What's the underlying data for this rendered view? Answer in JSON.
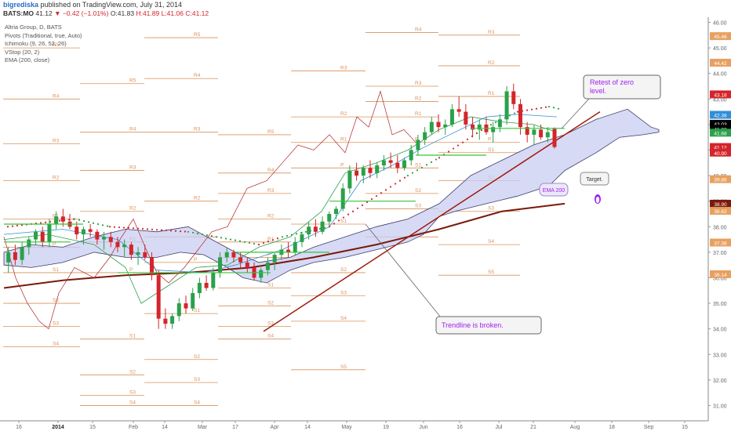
{
  "header": {
    "author": "bigrediska",
    "published": "published on TradingView.com, July 31, 2014"
  },
  "ticker": {
    "symbol": "BATS:MO",
    "last": "41.12",
    "change": "▼ −0.42 (−1.01%)",
    "open": "O:41.83",
    "high": "H:41.89",
    "low": "L:41.06",
    "close": "C:41.12"
  },
  "legend": [
    "Altria Group, D, BATS",
    "Pivots (Traditional, true, Auto)",
    "Ichimoku (9, 26, 52, 26)",
    "VStop (20, 2)",
    "EMA (200, close)"
  ],
  "colors": {
    "up": "#2aa14a",
    "down": "#d3252b",
    "pivot": "#d9905a",
    "trend": "#a01a0a",
    "ema": "#7a1a0a",
    "cloud_fill": "#c9cdf2",
    "cloud_line": "#3d3d6b",
    "annot": "#a020f0"
  },
  "chart_data": {
    "type": "candlestick",
    "symbol": "Altria Group, D, BATS",
    "ylim": [
      30.4,
      46.2
    ],
    "y_ticks": [
      31.0,
      32.0,
      33.0,
      34.0,
      35.0,
      36.0,
      37.0,
      38.0,
      39.0,
      40.0,
      41.0,
      42.0,
      43.0,
      44.0,
      45.0,
      46.0
    ],
    "x_ticks": [
      "16",
      "2014",
      "15",
      "Feb",
      "14",
      "Mar",
      "17",
      "Apr",
      "14",
      "May",
      "19",
      "Jun",
      "16",
      "Jul",
      "21",
      "Aug",
      "18",
      "Sep",
      "15"
    ],
    "price_tags": [
      {
        "label": "45.46",
        "value": 45.46,
        "color": "#e8a060"
      },
      {
        "label": "44.42",
        "value": 44.42,
        "color": "#e8a060"
      },
      {
        "label": "43.18",
        "value": 43.18,
        "color": "#d3252b"
      },
      {
        "label": "42.38",
        "value": 42.38,
        "color": "#2f8fd8"
      },
      {
        "label": "42.03",
        "value": 42.03,
        "color": "#000000"
      },
      {
        "label": "41.83",
        "value": 41.83,
        "color": "#000000"
      },
      {
        "label": "41.68",
        "value": 41.68,
        "color": "#2aa14a"
      },
      {
        "label": "41.12",
        "value": 41.12,
        "color": "#d3252b"
      },
      {
        "label": "40.90",
        "value": 40.9,
        "color": "#d3252b"
      },
      {
        "label": "39.86",
        "value": 39.86,
        "color": "#e8a060"
      },
      {
        "label": "38.90",
        "value": 38.9,
        "color": "#7a1a0a"
      },
      {
        "label": "38.62",
        "value": 38.62,
        "color": "#e8a060"
      },
      {
        "label": "37.38",
        "value": 37.38,
        "color": "#e8a060"
      },
      {
        "label": "36.14",
        "value": 36.14,
        "color": "#e8a060"
      }
    ],
    "pivot_levels": [
      {
        "label": "R5",
        "value": 45.0,
        "start": 75
      },
      {
        "label": "R4",
        "value": 43.0,
        "start": 75
      },
      {
        "label": "R3",
        "value": 41.25,
        "start": 75
      },
      {
        "label": "R2",
        "value": 39.8,
        "start": 75
      },
      {
        "label": "R1",
        "value": 38.3,
        "start": 75
      },
      {
        "label": "P",
        "value": 37.2,
        "start": 75
      },
      {
        "label": "S1",
        "value": 36.2,
        "start": 75
      },
      {
        "label": "S2",
        "value": 35.0,
        "start": 75
      },
      {
        "label": "S3",
        "value": 34.1,
        "start": 75
      },
      {
        "label": "S4",
        "value": 33.3,
        "start": 75
      },
      {
        "label": "R5",
        "value": 43.6,
        "start": 173
      },
      {
        "label": "R4",
        "value": 41.7,
        "start": 173
      },
      {
        "label": "R3",
        "value": 40.2,
        "start": 173
      },
      {
        "label": "R2",
        "value": 38.6,
        "start": 173
      },
      {
        "label": "R1",
        "value": 37.4,
        "start": 173
      },
      {
        "label": "P",
        "value": 36.2,
        "start": 173
      },
      {
        "label": "S1",
        "value": 33.6,
        "start": 173
      },
      {
        "label": "S2",
        "value": 32.2,
        "start": 173
      },
      {
        "label": "S3",
        "value": 31.4,
        "start": 173
      },
      {
        "label": "S4",
        "value": 31.0,
        "start": 173
      },
      {
        "label": "R5",
        "value": 45.4,
        "start": 255
      },
      {
        "label": "R4",
        "value": 43.8,
        "start": 255
      },
      {
        "label": "R3",
        "value": 41.7,
        "start": 255
      },
      {
        "label": "R2",
        "value": 39.0,
        "start": 255
      },
      {
        "label": "R1",
        "value": 37.6,
        "start": 255
      },
      {
        "label": "P",
        "value": 36.6,
        "start": 255
      },
      {
        "label": "S1",
        "value": 34.6,
        "start": 255
      },
      {
        "label": "S2",
        "value": 32.8,
        "start": 255
      },
      {
        "label": "S3",
        "value": 31.9,
        "start": 255
      },
      {
        "label": "S4",
        "value": 31.0,
        "start": 255
      },
      {
        "label": "R5",
        "value": 41.6,
        "start": 349
      },
      {
        "label": "R4",
        "value": 40.1,
        "start": 349
      },
      {
        "label": "R3",
        "value": 39.3,
        "start": 349
      },
      {
        "label": "R2",
        "value": 38.3,
        "start": 349
      },
      {
        "label": "R1",
        "value": 37.4,
        "start": 349
      },
      {
        "label": "P",
        "value": 36.8,
        "start": 349
      },
      {
        "label": "S1",
        "value": 35.6,
        "start": 349
      },
      {
        "label": "S2",
        "value": 34.9,
        "start": 349
      },
      {
        "label": "S3",
        "value": 34.1,
        "start": 349
      },
      {
        "label": "S4",
        "value": 33.6,
        "start": 349
      },
      {
        "label": "R4",
        "value": 46.5,
        "start": 442
      },
      {
        "label": "R3",
        "value": 44.1,
        "start": 442
      },
      {
        "label": "R2",
        "value": 42.3,
        "start": 442
      },
      {
        "label": "R1",
        "value": 41.3,
        "start": 442
      },
      {
        "label": "P",
        "value": 40.3,
        "start": 442
      },
      {
        "label": "S1",
        "value": 38.1,
        "start": 442
      },
      {
        "label": "S2",
        "value": 36.2,
        "start": 442
      },
      {
        "label": "S3",
        "value": 35.3,
        "start": 442
      },
      {
        "label": "S4",
        "value": 34.3,
        "start": 442
      },
      {
        "label": "S5",
        "value": 32.4,
        "start": 442
      },
      {
        "label": "R4",
        "value": 45.6,
        "start": 537
      },
      {
        "label": "R3",
        "value": 43.5,
        "start": 537
      },
      {
        "label": "R2",
        "value": 42.9,
        "start": 537
      },
      {
        "label": "R1",
        "value": 42.3,
        "start": 537
      },
      {
        "label": "P",
        "value": 41.3,
        "start": 537
      },
      {
        "label": "S1",
        "value": 40.3,
        "start": 537
      },
      {
        "label": "S2",
        "value": 39.3,
        "start": 537
      },
      {
        "label": "S3",
        "value": 38.7,
        "start": 537
      },
      {
        "label": "S4",
        "value": 37.6,
        "start": 537
      },
      {
        "label": "R3",
        "value": 45.5,
        "start": 630
      },
      {
        "label": "R2",
        "value": 44.3,
        "start": 630
      },
      {
        "label": "R1",
        "value": 43.1,
        "start": 630
      },
      {
        "label": "P",
        "value": 41.3,
        "start": 630
      },
      {
        "label": "S1",
        "value": 40.9,
        "start": 630
      },
      {
        "label": "S2",
        "value": 39.8,
        "start": 630
      },
      {
        "label": "S3",
        "value": 38.6,
        "start": 630
      },
      {
        "label": "S4",
        "value": 37.3,
        "start": 630
      },
      {
        "label": "S5",
        "value": 36.1,
        "start": 630
      }
    ],
    "candles": [
      [
        36.6,
        37.2,
        36.2,
        37.0
      ],
      [
        37.0,
        37.3,
        36.5,
        36.7
      ],
      [
        36.7,
        37.4,
        36.5,
        37.2
      ],
      [
        37.2,
        37.6,
        36.9,
        37.5
      ],
      [
        37.5,
        37.9,
        37.3,
        37.8
      ],
      [
        37.8,
        38.0,
        37.2,
        37.4
      ],
      [
        37.4,
        38.3,
        37.2,
        38.1
      ],
      [
        38.1,
        38.6,
        37.9,
        38.4
      ],
      [
        38.4,
        38.7,
        38.0,
        38.2
      ],
      [
        38.2,
        38.5,
        37.9,
        38.0
      ],
      [
        38.0,
        38.2,
        37.5,
        37.7
      ],
      [
        37.7,
        38.0,
        37.3,
        37.9
      ],
      [
        37.9,
        38.1,
        37.6,
        37.8
      ],
      [
        37.8,
        37.9,
        37.3,
        37.5
      ],
      [
        37.5,
        37.8,
        37.1,
        37.6
      ],
      [
        37.6,
        37.8,
        37.2,
        37.4
      ],
      [
        37.4,
        37.6,
        37.0,
        37.2
      ],
      [
        37.2,
        37.5,
        36.8,
        37.3
      ],
      [
        37.3,
        37.4,
        36.7,
        36.9
      ],
      [
        36.9,
        37.2,
        36.5,
        37.0
      ],
      [
        37.0,
        37.3,
        36.7,
        36.8
      ],
      [
        36.8,
        37.0,
        35.9,
        36.1
      ],
      [
        36.1,
        36.3,
        34.0,
        34.4
      ],
      [
        34.4,
        34.8,
        34.0,
        34.2
      ],
      [
        34.2,
        34.6,
        34.0,
        34.5
      ],
      [
        34.5,
        35.2,
        34.3,
        35.0
      ],
      [
        35.0,
        35.3,
        34.6,
        34.8
      ],
      [
        34.8,
        35.6,
        34.7,
        35.4
      ],
      [
        35.4,
        36.0,
        35.2,
        35.8
      ],
      [
        35.8,
        36.1,
        35.5,
        35.6
      ],
      [
        35.6,
        36.4,
        35.5,
        36.2
      ],
      [
        36.2,
        37.0,
        36.0,
        36.8
      ],
      [
        36.8,
        37.2,
        36.6,
        37.0
      ],
      [
        37.0,
        37.1,
        36.6,
        36.8
      ],
      [
        36.8,
        37.0,
        36.4,
        36.6
      ],
      [
        36.6,
        36.8,
        36.2,
        36.4
      ],
      [
        36.4,
        36.6,
        35.9,
        36.0
      ],
      [
        36.0,
        36.4,
        35.8,
        36.3
      ],
      [
        36.3,
        36.8,
        36.1,
        36.6
      ],
      [
        36.6,
        37.0,
        36.3,
        36.9
      ],
      [
        36.9,
        37.3,
        36.7,
        37.1
      ],
      [
        37.1,
        37.4,
        36.8,
        37.0
      ],
      [
        37.0,
        37.6,
        36.9,
        37.4
      ],
      [
        37.4,
        37.8,
        37.2,
        37.7
      ],
      [
        37.7,
        38.2,
        37.5,
        38.0
      ],
      [
        38.0,
        38.3,
        37.6,
        37.8
      ],
      [
        37.8,
        38.4,
        37.7,
        38.2
      ],
      [
        38.2,
        38.6,
        38.0,
        38.5
      ],
      [
        38.5,
        38.8,
        38.3,
        38.7
      ],
      [
        38.7,
        39.7,
        38.6,
        39.5
      ],
      [
        39.5,
        40.4,
        39.3,
        40.2
      ],
      [
        40.2,
        40.5,
        39.8,
        40.0
      ],
      [
        40.0,
        40.4,
        39.7,
        40.3
      ],
      [
        40.3,
        40.6,
        39.9,
        40.1
      ],
      [
        40.1,
        40.5,
        39.9,
        40.4
      ],
      [
        40.4,
        40.8,
        40.2,
        40.6
      ],
      [
        40.6,
        40.9,
        40.3,
        40.5
      ],
      [
        40.5,
        40.8,
        40.1,
        40.3
      ],
      [
        40.3,
        40.7,
        40.2,
        40.6
      ],
      [
        40.6,
        41.2,
        40.4,
        41.0
      ],
      [
        41.0,
        41.6,
        40.8,
        41.4
      ],
      [
        41.4,
        41.9,
        41.2,
        41.7
      ],
      [
        41.7,
        42.3,
        41.6,
        42.1
      ],
      [
        42.1,
        42.4,
        41.7,
        41.9
      ],
      [
        41.9,
        42.2,
        41.6,
        42.0
      ],
      [
        42.0,
        42.8,
        41.9,
        42.6
      ],
      [
        42.6,
        43.1,
        42.3,
        42.5
      ],
      [
        42.5,
        42.8,
        41.8,
        42.0
      ],
      [
        42.0,
        42.3,
        41.5,
        41.8
      ],
      [
        41.8,
        42.2,
        41.4,
        42.0
      ],
      [
        42.0,
        42.3,
        41.6,
        41.7
      ],
      [
        41.7,
        42.1,
        41.3,
        41.9
      ],
      [
        41.9,
        42.4,
        41.7,
        42.2
      ],
      [
        42.2,
        43.5,
        42.0,
        43.3
      ],
      [
        43.3,
        43.6,
        42.6,
        42.8
      ],
      [
        42.8,
        43.0,
        41.6,
        41.9
      ],
      [
        41.9,
        42.1,
        41.3,
        41.6
      ],
      [
        41.6,
        42.0,
        41.2,
        41.8
      ],
      [
        41.8,
        42.0,
        41.4,
        41.5
      ],
      [
        41.5,
        41.9,
        41.3,
        41.7
      ],
      [
        41.83,
        41.89,
        41.06,
        41.12
      ]
    ],
    "trendline": {
      "from": [
        36,
        33.9
      ],
      "to": [
        88,
        42.5
      ]
    },
    "annotations": [
      "Retest of zero level.",
      "Trendline is broken.",
      "Target.",
      "EMA 200"
    ]
  }
}
